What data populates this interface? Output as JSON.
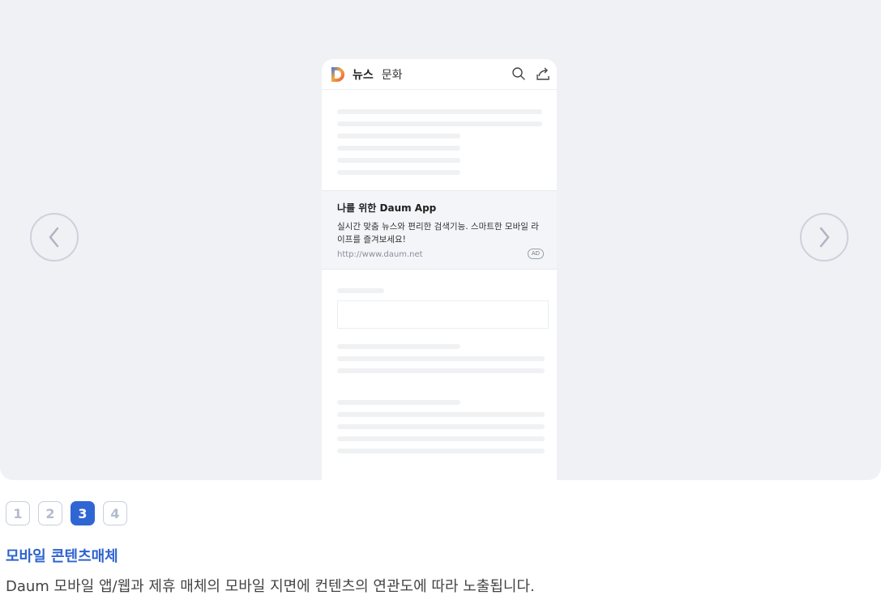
{
  "phone": {
    "news_label": "뉴스",
    "category": "문화",
    "icons": {
      "logo": "daum-logo-icon",
      "search": "search-icon",
      "share": "share-icon"
    }
  },
  "ad": {
    "title": "나를 위한 Daum App",
    "description": "실시간 맞춤 뉴스와 편리한 검색기능. 스마트한 모바일 라이프를 즐겨보세요!",
    "url": "http://www.daum.net",
    "badge": "AD"
  },
  "carousel": {
    "prev_icon": "chevron-left-icon",
    "next_icon": "chevron-right-icon"
  },
  "pagination": {
    "pages": [
      "1",
      "2",
      "3",
      "4"
    ],
    "active_index": 2
  },
  "section": {
    "title": "모바일 콘텐츠매체",
    "description": "Daum 모바일 앱/웹과 제휴 매체의 모바일 지면에 컨텐츠의 연관도에 따라 노출됩니다."
  },
  "colors": {
    "accent": "#3066d4",
    "stage_bg": "#f0f1f5"
  }
}
